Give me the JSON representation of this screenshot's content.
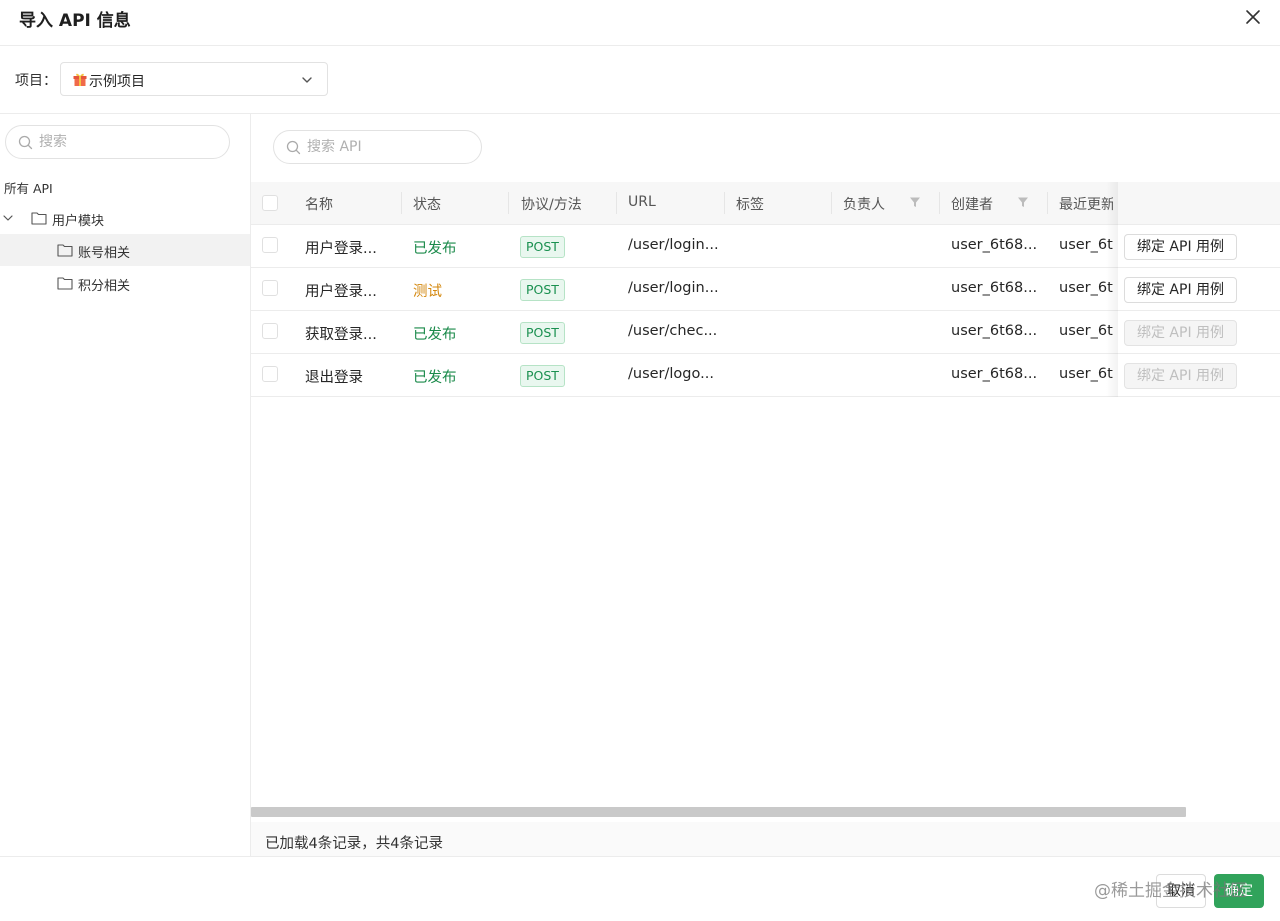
{
  "dialog": {
    "title": "导入 API 信息"
  },
  "project": {
    "label": "项目：",
    "value": "示例项目"
  },
  "sidebar": {
    "search_placeholder": "搜索",
    "all_api_label": "所有 API",
    "tree": [
      {
        "label": "用户模块",
        "expanded": true
      },
      {
        "label": "账号相关",
        "active": true
      },
      {
        "label": "积分相关"
      }
    ]
  },
  "main": {
    "search_placeholder": "搜索 API",
    "columns": [
      "名称",
      "状态",
      "协议/方法",
      "URL",
      "标签",
      "负责人",
      "创建者",
      "最近更新"
    ],
    "rows": [
      {
        "name": "用户登录...",
        "status": "已发布",
        "status_type": "published",
        "method": "POST",
        "url": "/user/login...",
        "tags": "",
        "owner": "",
        "creator": "user_6t68...",
        "updated": "user_6t",
        "action": "绑定 API 用例",
        "action_enabled": true
      },
      {
        "name": "用户登录...",
        "status": "测试",
        "status_type": "testing",
        "method": "POST",
        "url": "/user/login...",
        "tags": "",
        "owner": "",
        "creator": "user_6t68...",
        "updated": "user_6t",
        "action": "绑定 API 用例",
        "action_enabled": true
      },
      {
        "name": "获取登录...",
        "status": "已发布",
        "status_type": "published",
        "method": "POST",
        "url": "/user/chec...",
        "tags": "",
        "owner": "",
        "creator": "user_6t68...",
        "updated": "user_6t",
        "action": "绑定 API 用例",
        "action_enabled": false
      },
      {
        "name": "退出登录",
        "status": "已发布",
        "status_type": "published",
        "method": "POST",
        "url": "/user/logo...",
        "tags": "",
        "owner": "",
        "creator": "user_6t68...",
        "updated": "user_6t",
        "action": "绑定 API 用例",
        "action_enabled": false
      }
    ],
    "footer_text": "已加载4条记录，共4条记录"
  },
  "footer": {
    "cancel_label": "取消",
    "ok_label": "确定",
    "watermark": "@稀土掘金技术社区"
  },
  "colors": {
    "primary": "#31a35b",
    "published": "#1a8a4a",
    "testing": "#d4880f"
  },
  "icons": [
    "close-icon",
    "gift-icon",
    "chevron-down-icon",
    "search-icon",
    "caret-down-icon",
    "folder-icon",
    "filter-icon"
  ]
}
